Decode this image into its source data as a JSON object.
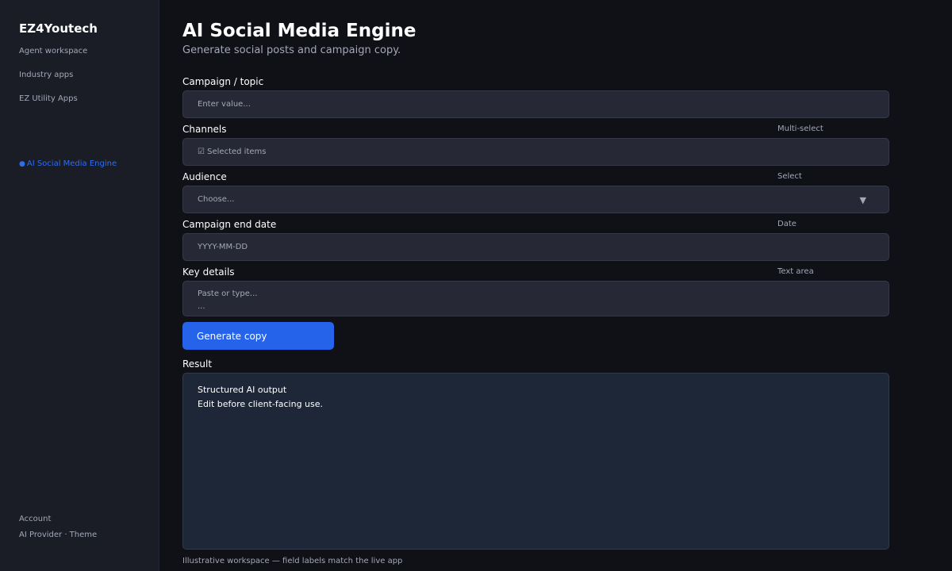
{
  "sidebar": {
    "brand": "EZ4Youtech",
    "nav": [
      {
        "label": "Agent workspace"
      },
      {
        "label": "Industry apps"
      },
      {
        "label": "EZ Utility Apps"
      }
    ],
    "active_item": {
      "dot": "●",
      "label": "AI Social Media Engine"
    },
    "footer": {
      "account": "Account",
      "provider_theme": "AI Provider · Theme"
    }
  },
  "page": {
    "title": "AI Social Media Engine",
    "subtitle": "Generate social posts and campaign copy."
  },
  "form": {
    "fields": [
      {
        "label": "Campaign / topic",
        "kind": "",
        "placeholder": "Enter value..."
      },
      {
        "label": "Channels",
        "kind": "Multi-select",
        "placeholder": "☑ Selected items"
      },
      {
        "label": "Audience",
        "kind": "Select",
        "placeholder": "Choose..."
      },
      {
        "label": "Campaign end date",
        "kind": "Date",
        "placeholder": "YYYY-MM-DD"
      },
      {
        "label": "Key details",
        "kind": "Text area",
        "placeholder_line1": "Paste or type...",
        "placeholder_line2": "..."
      }
    ],
    "generate_label": "Generate copy"
  },
  "result": {
    "label": "Result",
    "line1": "Structured AI output",
    "line2": "Edit before client-facing use."
  },
  "footnote": "Illustrative workspace — field labels match the live app",
  "colors": {
    "accent": "#2563eb",
    "active_nav": "#2f6df0",
    "background": "#0f1117",
    "sidebar": "#1a1c26"
  },
  "icons": {
    "dropdown": "chevron-down-icon",
    "active_dot": "dot-icon"
  }
}
